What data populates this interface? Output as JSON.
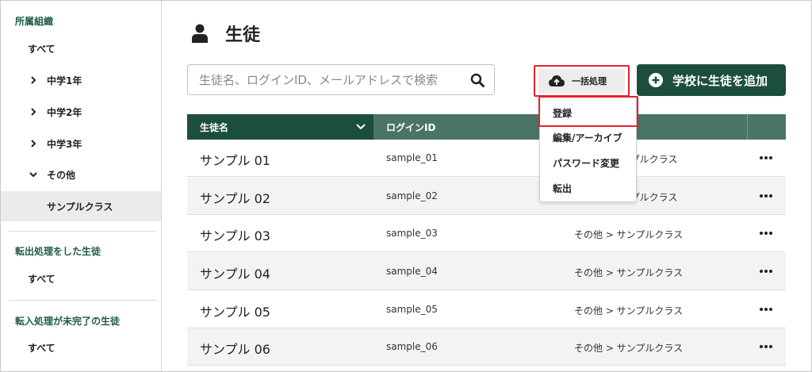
{
  "sidebar": {
    "org_heading": "所属組織",
    "all_label": "すべて",
    "items": [
      {
        "label": "中学1年",
        "expanded": false
      },
      {
        "label": "中学2年",
        "expanded": false
      },
      {
        "label": "中学3年",
        "expanded": false
      },
      {
        "label": "その他",
        "expanded": true
      }
    ],
    "sub_item": "サンプルクラス",
    "transfer_out_heading": "転出処理をした生徒",
    "transfer_out_all": "すべて",
    "transfer_in_heading": "転入処理が未完了の生徒",
    "transfer_in_all": "すべて"
  },
  "page": {
    "title": "生徒",
    "icon": "person-icon"
  },
  "search": {
    "placeholder": "生徒名、ログインID、メールアドレスで検索",
    "value": ""
  },
  "batch_button": {
    "label": "一括処理",
    "icon": "cloud-upload-icon"
  },
  "add_button": {
    "label": "学校に生徒を追加",
    "icon": "plus-circle-icon"
  },
  "menu": {
    "items": [
      "登録",
      "編集/アーカイブ",
      "パスワード変更",
      "転出"
    ]
  },
  "table": {
    "headers": {
      "name": "生徒名",
      "login": "ログインID"
    },
    "rows": [
      {
        "name": "サンプル 01",
        "login": "sample_01",
        "class": "ンプルクラス"
      },
      {
        "name": "サンプル 02",
        "login": "sample_02",
        "class": "ンプルクラス"
      },
      {
        "name": "サンプル 03",
        "login": "sample_03",
        "class": "その他 > サンプルクラス"
      },
      {
        "name": "サンプル 04",
        "login": "sample_04",
        "class": "その他 > サンプルクラス"
      },
      {
        "name": "サンプル 05",
        "login": "sample_05",
        "class": "その他 > サンプルクラス"
      },
      {
        "name": "サンプル 06",
        "login": "sample_06",
        "class": "その他 > サンプルクラス"
      }
    ]
  },
  "colors": {
    "brand": "#1c4e3c",
    "header_mid": "#4a7565",
    "highlight": "#e2232e"
  }
}
